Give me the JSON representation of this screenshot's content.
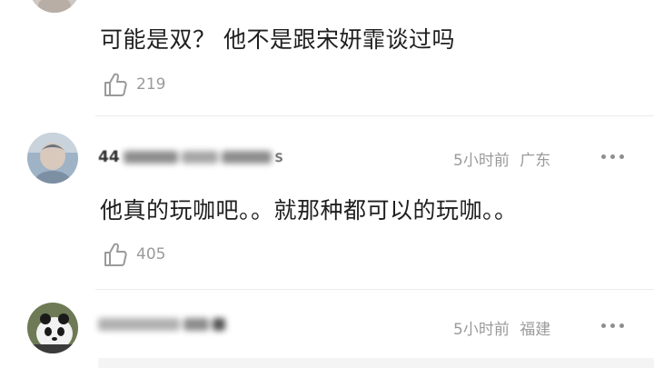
{
  "comments": [
    {
      "text": "可能是双？  他不是跟宋妍霏谈过吗",
      "likes": "219",
      "like_icon": "thumbs-up-icon"
    },
    {
      "username_visible_prefix": "44",
      "username_visible_suffix": "s",
      "time": "5小时前",
      "location": "广东",
      "text": "他真的玩咖吧。。就那种都可以的玩咖。。",
      "likes": "405",
      "like_icon": "thumbs-up-icon",
      "more_icon": "more-dots-icon"
    },
    {
      "time": "5小时前",
      "location": "福建",
      "more_icon": "more-dots-icon",
      "avatar": "panda-avatar"
    }
  ]
}
